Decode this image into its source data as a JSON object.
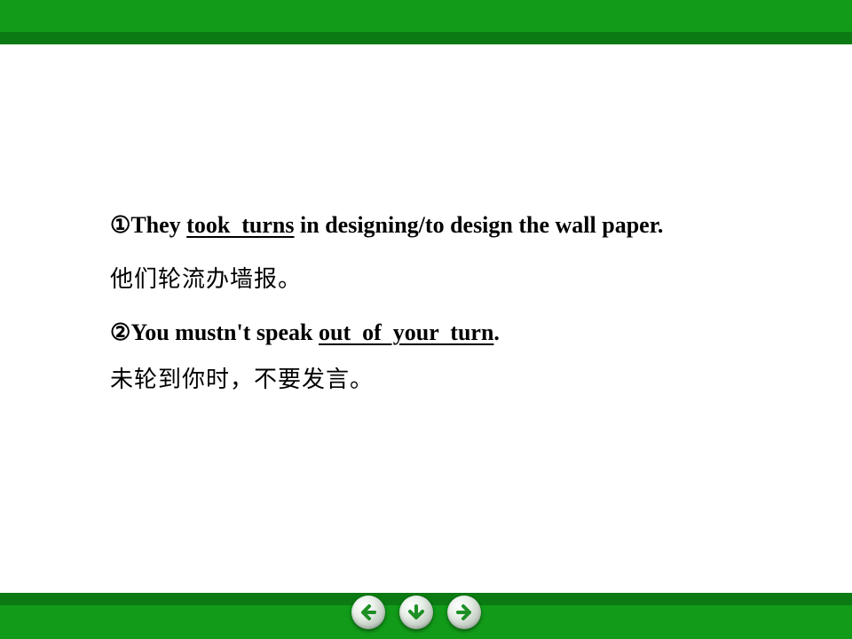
{
  "slide": {
    "items": [
      {
        "marker": "①",
        "before": "They ",
        "answer": "took  turns",
        "after": " in designing/to design the wall paper.",
        "translation": "他们轮流办墙报。"
      },
      {
        "marker": "②",
        "before": "You mustn't speak ",
        "answer": "out  of  your  turn",
        "after": ".",
        "translation": "未轮到你时，不要发言。"
      }
    ]
  },
  "nav": {
    "buttons": [
      {
        "name": "previous",
        "icon": "arrow-left-icon"
      },
      {
        "name": "down",
        "icon": "arrow-down-icon"
      },
      {
        "name": "next",
        "icon": "arrow-right-icon"
      }
    ]
  },
  "colors": {
    "bar_green": "#119b19",
    "bar_green_dark": "#0b7a12",
    "arrow_green": "#1d8f24"
  }
}
